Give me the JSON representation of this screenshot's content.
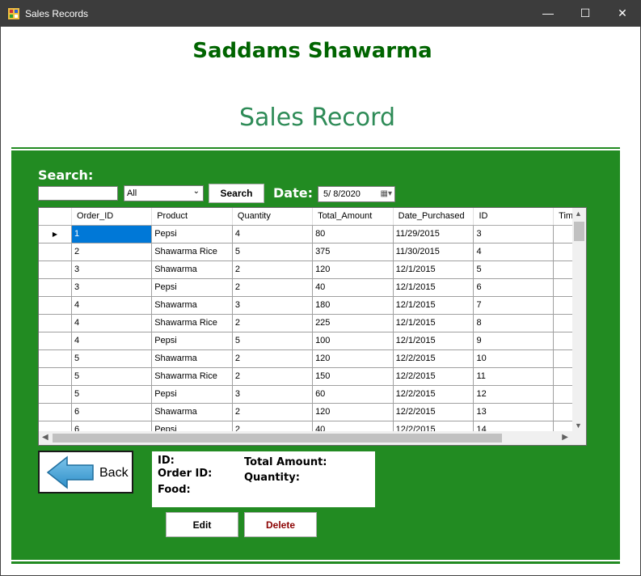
{
  "window": {
    "title": "Sales Records",
    "minimize": "—",
    "maximize": "☐",
    "close": "✕"
  },
  "header": {
    "brand": "Saddams Shawarma",
    "title": "Sales Record"
  },
  "search": {
    "label": "Search:",
    "input_value": "",
    "filter_selected": "All",
    "button": "Search"
  },
  "date": {
    "label": "Date:",
    "value": "5/ 8/2020"
  },
  "table": {
    "columns": [
      "Order_ID",
      "Product",
      "Quantity",
      "Total_Amount",
      "Date_Purchased",
      "ID",
      "Tim"
    ],
    "rows": [
      [
        "1",
        "Pepsi",
        "4",
        "80",
        "11/29/2015",
        "3",
        ""
      ],
      [
        "2",
        "Shawarma Rice",
        "5",
        "375",
        "11/30/2015",
        "4",
        ""
      ],
      [
        "3",
        "Shawarma",
        "2",
        "120",
        "12/1/2015",
        "5",
        ""
      ],
      [
        "3",
        "Pepsi",
        "2",
        "40",
        "12/1/2015",
        "6",
        ""
      ],
      [
        "4",
        "Shawarma",
        "3",
        "180",
        "12/1/2015",
        "7",
        ""
      ],
      [
        "4",
        "Shawarma Rice",
        "2",
        "225",
        "12/1/2015",
        "8",
        ""
      ],
      [
        "4",
        "Pepsi",
        "5",
        "100",
        "12/1/2015",
        "9",
        ""
      ],
      [
        "5",
        "Shawarma",
        "2",
        "120",
        "12/2/2015",
        "10",
        ""
      ],
      [
        "5",
        "Shawarma Rice",
        "2",
        "150",
        "12/2/2015",
        "11",
        ""
      ],
      [
        "5",
        "Pepsi",
        "3",
        "60",
        "12/2/2015",
        "12",
        ""
      ],
      [
        "6",
        "Shawarma",
        "2",
        "120",
        "12/2/2015",
        "13",
        ""
      ],
      [
        "6",
        "Pepsi",
        "2",
        "40",
        "12/2/2015",
        "14",
        ""
      ]
    ]
  },
  "back": {
    "label": "Back"
  },
  "details": {
    "id_label": "ID:",
    "order_id_label": "Order ID:",
    "food_label": "Food:",
    "total_label": "Total Amount:",
    "quantity_label": "Quantity:"
  },
  "actions": {
    "edit": "Edit",
    "delete": "Delete"
  },
  "colors": {
    "panel": "#228b22",
    "brand": "#006400",
    "title": "#2e8b57",
    "selection": "#0078d7",
    "delete_text": "#8b0000"
  }
}
